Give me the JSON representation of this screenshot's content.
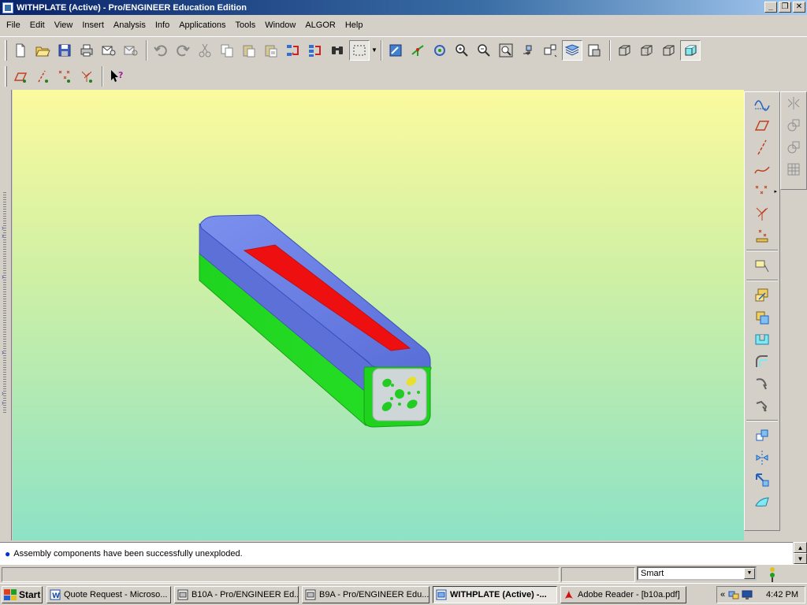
{
  "window": {
    "title": "WITHPLATE (Active) - Pro/ENGINEER Education Edition",
    "min_label": "_",
    "max_label": "❐",
    "close_label": "✕"
  },
  "menubar": {
    "items": [
      {
        "label": "File"
      },
      {
        "label": "Edit"
      },
      {
        "label": "View"
      },
      {
        "label": "Insert"
      },
      {
        "label": "Analysis"
      },
      {
        "label": "Info"
      },
      {
        "label": "Applications"
      },
      {
        "label": "Tools"
      },
      {
        "label": "Window"
      },
      {
        "label": "ALGOR"
      },
      {
        "label": "Help"
      }
    ]
  },
  "toolbar_main": {
    "icons": [
      "new-icon",
      "open-icon",
      "save-icon",
      "print-icon",
      "email-icon",
      "email-link-icon",
      "undo-icon",
      "redo-icon",
      "cut-icon",
      "copy-icon",
      "paste-icon",
      "paste-special-icon",
      "regenerate-icon",
      "regen-manager-icon",
      "find-icon",
      "select-box-icon",
      "repaint-icon",
      "spin-center-icon",
      "orient-icon",
      "zoom-in-icon",
      "zoom-out-icon",
      "refit-icon",
      "reorient-icon",
      "saved-views-icon",
      "layers-icon",
      "view-manager-icon",
      "wireframe-icon",
      "hidden-line-icon",
      "no-hidden-icon",
      "shading-icon"
    ]
  },
  "toolbar_datum": {
    "icons": [
      "datum-plane-display-icon",
      "datum-axis-display-icon",
      "point-display-icon",
      "csys-display-icon",
      "context-help-icon"
    ]
  },
  "right_toolbar": {
    "icons": [
      "sketch-curve-icon",
      "datum-plane-icon",
      "datum-axis-icon",
      "datum-curve-icon",
      "datum-point-icon",
      "datum-csys-icon",
      "analysis-feature-icon",
      "annotation-icon",
      "assemble-icon",
      "create-component-icon",
      "cut-out-icon",
      "round-icon",
      "draft-icon",
      "shell-icon",
      "pattern-icon",
      "mirror-icon",
      "move-icon",
      "surface-icon"
    ],
    "secondary_icons": [
      "mirror-surface-icon",
      "offset-icon",
      "thicken-icon",
      "grid-icon"
    ]
  },
  "message": {
    "text": "Assembly components have been successfully unexploded."
  },
  "status": {
    "filter_value": "Smart",
    "filter_arrow": "▼"
  },
  "taskbar": {
    "start_label": "Start",
    "tasks": [
      {
        "label": "Quote Request - Microso..."
      },
      {
        "label": "B10A - Pro/ENGINEER Ed..."
      },
      {
        "label": "B9A - Pro/ENGINEER Edu..."
      },
      {
        "label": "WITHPLATE (Active) -..."
      },
      {
        "label": "Adobe Reader - [b10a.pdf]"
      }
    ],
    "tray_expand": "«",
    "clock": "4:42 PM"
  },
  "model": {
    "top_color": "#6a7fe0",
    "side_color": "#22dd22",
    "insert_color": "#ee0f0f",
    "endplate_color": "#cfd6d8",
    "hole_color": "#22cc22"
  },
  "colors": {
    "title_start": "#0a246a",
    "viewport_top": "#fbfa9e",
    "viewport_bottom": "#8de2c6"
  }
}
